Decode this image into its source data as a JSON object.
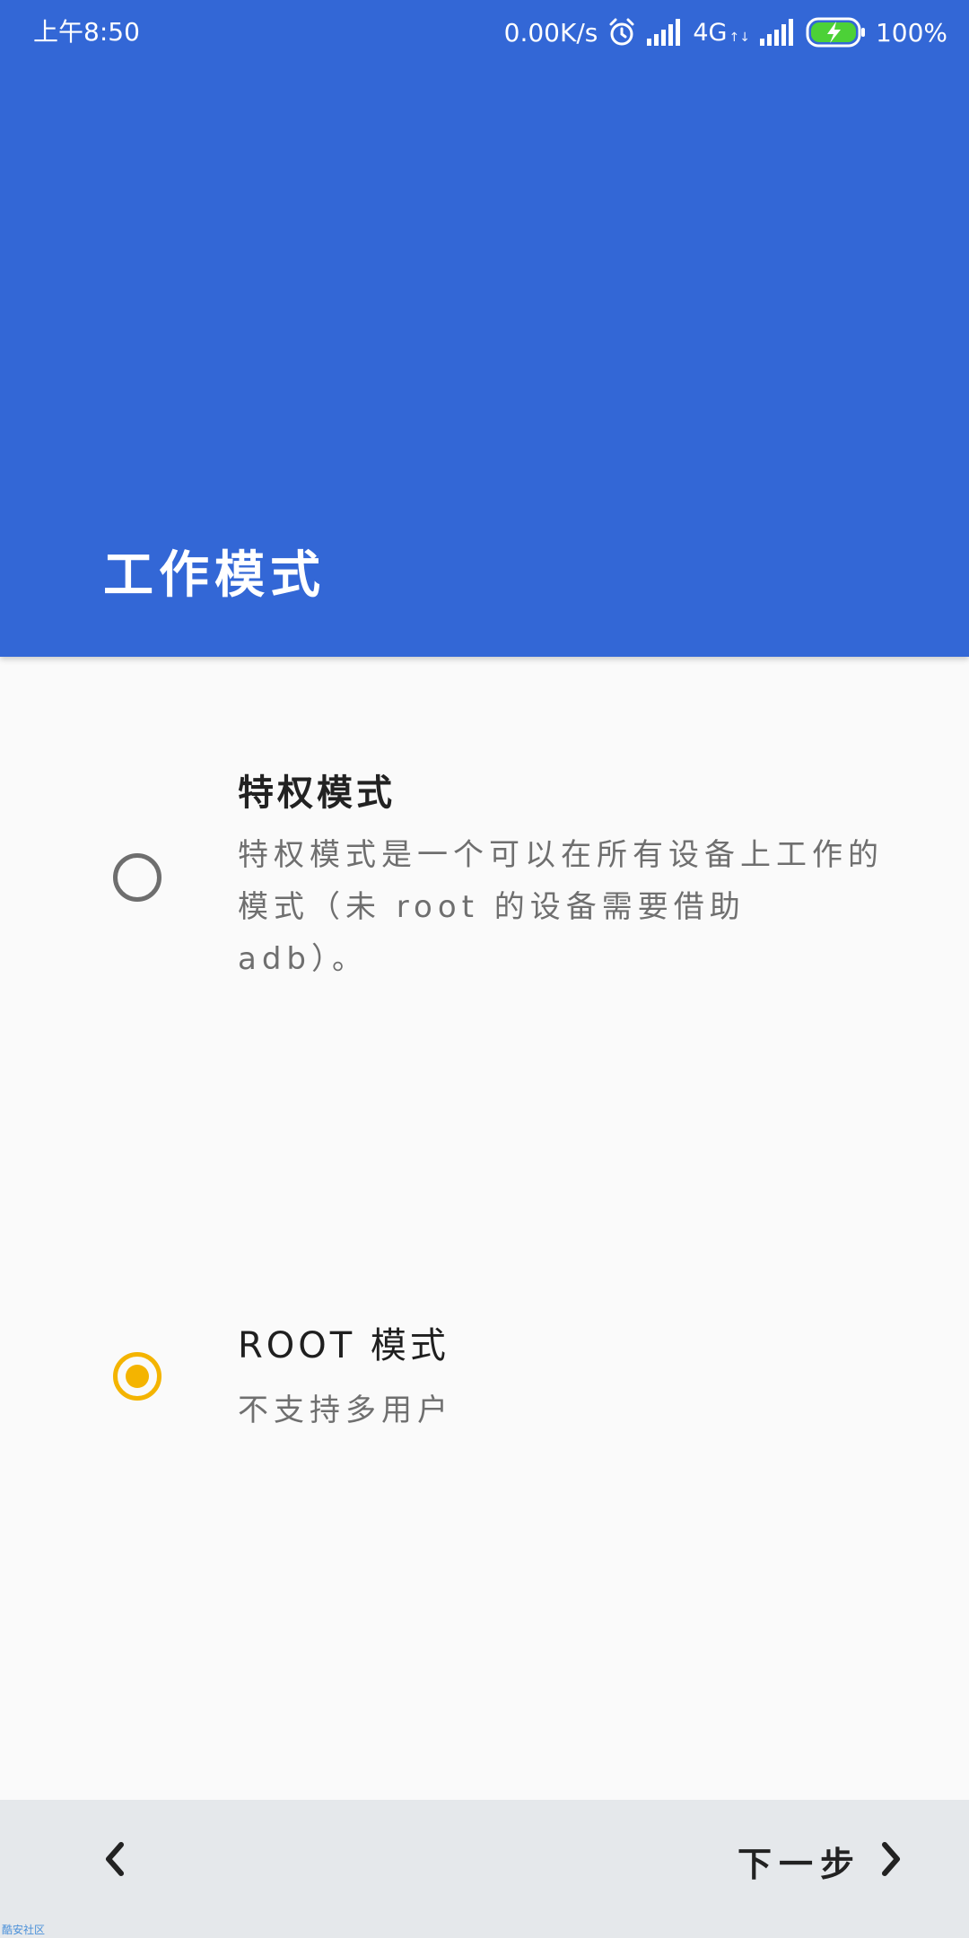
{
  "status_bar": {
    "time": "上午8:50",
    "net_speed": "0.00K/s",
    "network_type": "4G",
    "network_arrows": "↑↓",
    "battery": "100%"
  },
  "header": {
    "title": "工作模式"
  },
  "options": [
    {
      "title": "特权模式",
      "description": "特权模式是一个可以在所有设备上工作的模式（未 root 的设备需要借助 adb）。",
      "selected": false
    },
    {
      "title": "ROOT 模式",
      "description": "不支持多用户",
      "selected": true
    }
  ],
  "bottom_bar": {
    "next_label": "下一步"
  },
  "watermark": "酷安社区",
  "colors": {
    "header": "#3367d6",
    "accent": "#f4b400",
    "background": "#fafafa",
    "bottom_bar": "#e5e8eb"
  },
  "icons": {
    "alarm": "alarm-icon",
    "signal": "signal-icon",
    "battery": "battery-charging-icon",
    "back": "chevron-left-icon",
    "next": "chevron-right-icon"
  }
}
